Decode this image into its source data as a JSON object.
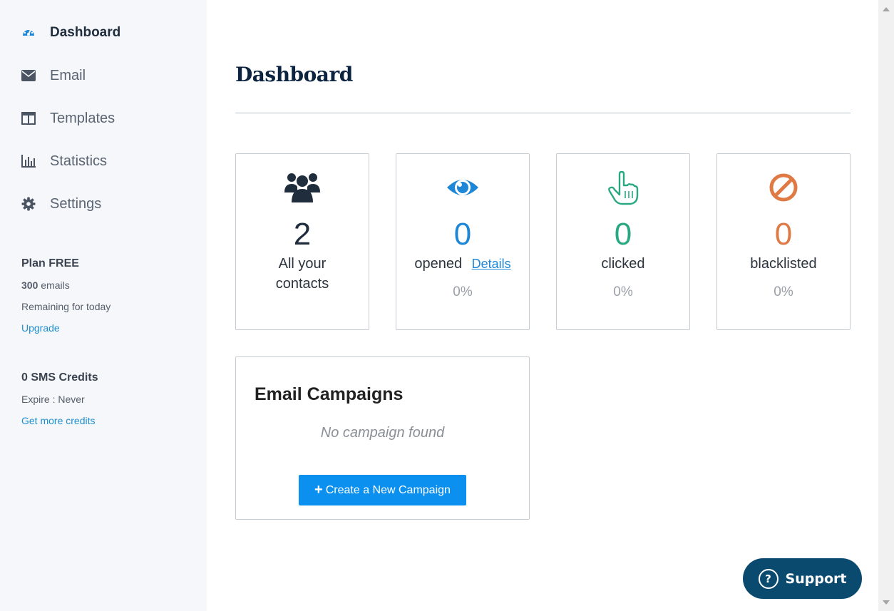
{
  "sidebar": {
    "items": [
      {
        "label": "Dashboard",
        "icon": "dashboard-gauge-icon"
      },
      {
        "label": "Email",
        "icon": "envelope-icon"
      },
      {
        "label": "Templates",
        "icon": "templates-layout-icon"
      },
      {
        "label": "Statistics",
        "icon": "bar-chart-icon"
      },
      {
        "label": "Settings",
        "icon": "gear-icon"
      }
    ],
    "plan": {
      "title": "Plan FREE",
      "emails_count": "300",
      "emails_suffix": "emails",
      "remaining": "Remaining for today",
      "upgrade": "Upgrade"
    },
    "sms": {
      "title": "0 SMS Credits",
      "expire": "Expire : Never",
      "get_more": "Get more credits"
    }
  },
  "main": {
    "title": "Dashboard",
    "stats": [
      {
        "value": "2",
        "label_line1": "All your",
        "label_line2": "contacts",
        "color": "#1f2d3d",
        "icon": "users-icon"
      },
      {
        "value": "0",
        "label": "opened",
        "link": "Details",
        "percent": "0%",
        "color": "#1d86d6",
        "icon": "eye-icon"
      },
      {
        "value": "0",
        "label": "clicked",
        "percent": "0%",
        "color": "#2aa882",
        "icon": "pointer-hand-icon"
      },
      {
        "value": "0",
        "label": "blacklisted",
        "percent": "0%",
        "color": "#e07a45",
        "icon": "ban-icon"
      }
    ],
    "campaigns": {
      "title": "Email Campaigns",
      "empty": "No campaign found",
      "button": "Create a New Campaign",
      "button_icon": "+"
    }
  },
  "support": {
    "label": "Support",
    "icon": "?"
  },
  "colors": {
    "accent": "#0b90f0",
    "link": "#1d8fd1",
    "support_bg": "#0b4a6f"
  }
}
